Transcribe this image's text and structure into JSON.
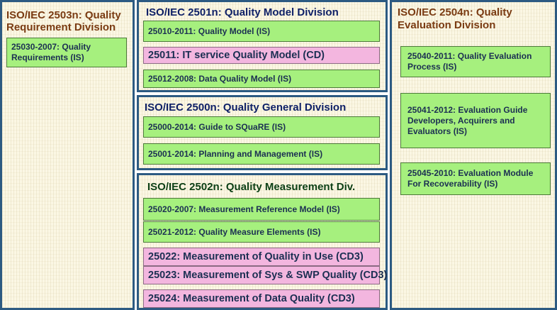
{
  "divisions": {
    "requirement": {
      "title": "ISO/IEC 2503n: Quality Requirement Division",
      "standards": [
        "25030-2007: Quality Requirements (IS)"
      ]
    },
    "model": {
      "title": "ISO/IEC 2501n:  Quality Model Division",
      "standards": [
        "25010-2011: Quality Model (IS)",
        "25011: IT service Quality Model (CD)",
        "25012-2008: Data Quality Model (IS)"
      ]
    },
    "general": {
      "title": "ISO/IEC 2500n: Quality General Division",
      "standards": [
        "25000-2014: Guide to SQuaRE (IS)",
        "25001-2014: Planning and Management (IS)"
      ]
    },
    "measurement": {
      "title": "ISO/IEC 2502n: Quality Measurement Div.",
      "standards": [
        "25020-2007: Measurement Reference Model (IS)",
        "25021-2012: Quality Measure Elements (IS)",
        "25022: Measurement of Quality in Use  (CD3)",
        "25023: Measurement of Sys & SWP Quality (CD3)",
        "25024: Measurement of Data Quality (CD3)"
      ]
    },
    "evaluation": {
      "title": "ISO/IEC 2504n: Quality Evaluation Division",
      "standards": [
        "25040-2011: Quality Evaluation Process (IS)",
        "25041-2012: Evaluation Guide Developers, Acquirers and Evaluators (IS)",
        "25045-2010: Evaluation Module For Recoverability (IS)"
      ]
    }
  },
  "colors": {
    "border": "#2c5a82",
    "background": "#fbf7e4",
    "is_box": "#a6f07e",
    "draft_box": "#f3b6df",
    "side_title": "#7a3b12",
    "center_title": "#0d1f66"
  }
}
